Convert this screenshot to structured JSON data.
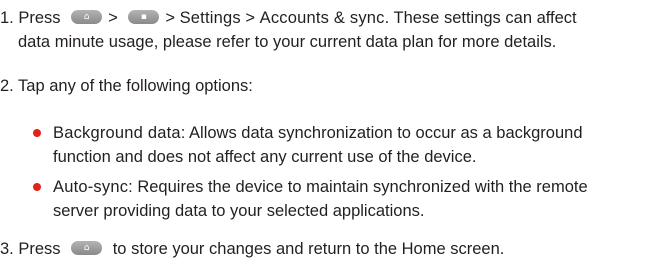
{
  "step1": {
    "number": "1. Press",
    "sep1": ">",
    "sep2": "> ",
    "settings": "Settings",
    "sep3": " > ",
    "accounts": "Accounts & sync",
    "rest_line1": ". These settings can affect",
    "line2": "data minute usage, please refer to your current data plan for more details.",
    "home_icon_glyph": "⌂",
    "menu_icon_glyph": "▪"
  },
  "step2": {
    "text": "2. Tap any of the following options:"
  },
  "options": [
    {
      "term": "Background data",
      "line1": ": Allows data synchronization to occur as a background",
      "line2": "function and does not affect any current use of the device."
    },
    {
      "term": "Auto-sync",
      "line1": ": Requires the device to maintain synchronized with the remote",
      "line2": "server providing data to your selected applications."
    }
  ],
  "step3": {
    "number": "3. Press",
    "text": "to store your changes and return to the Home screen.",
    "home_icon_glyph": "⌂"
  },
  "colors": {
    "bullet": "#e2231a",
    "text": "#231f20",
    "key": "#9a9a9a"
  }
}
